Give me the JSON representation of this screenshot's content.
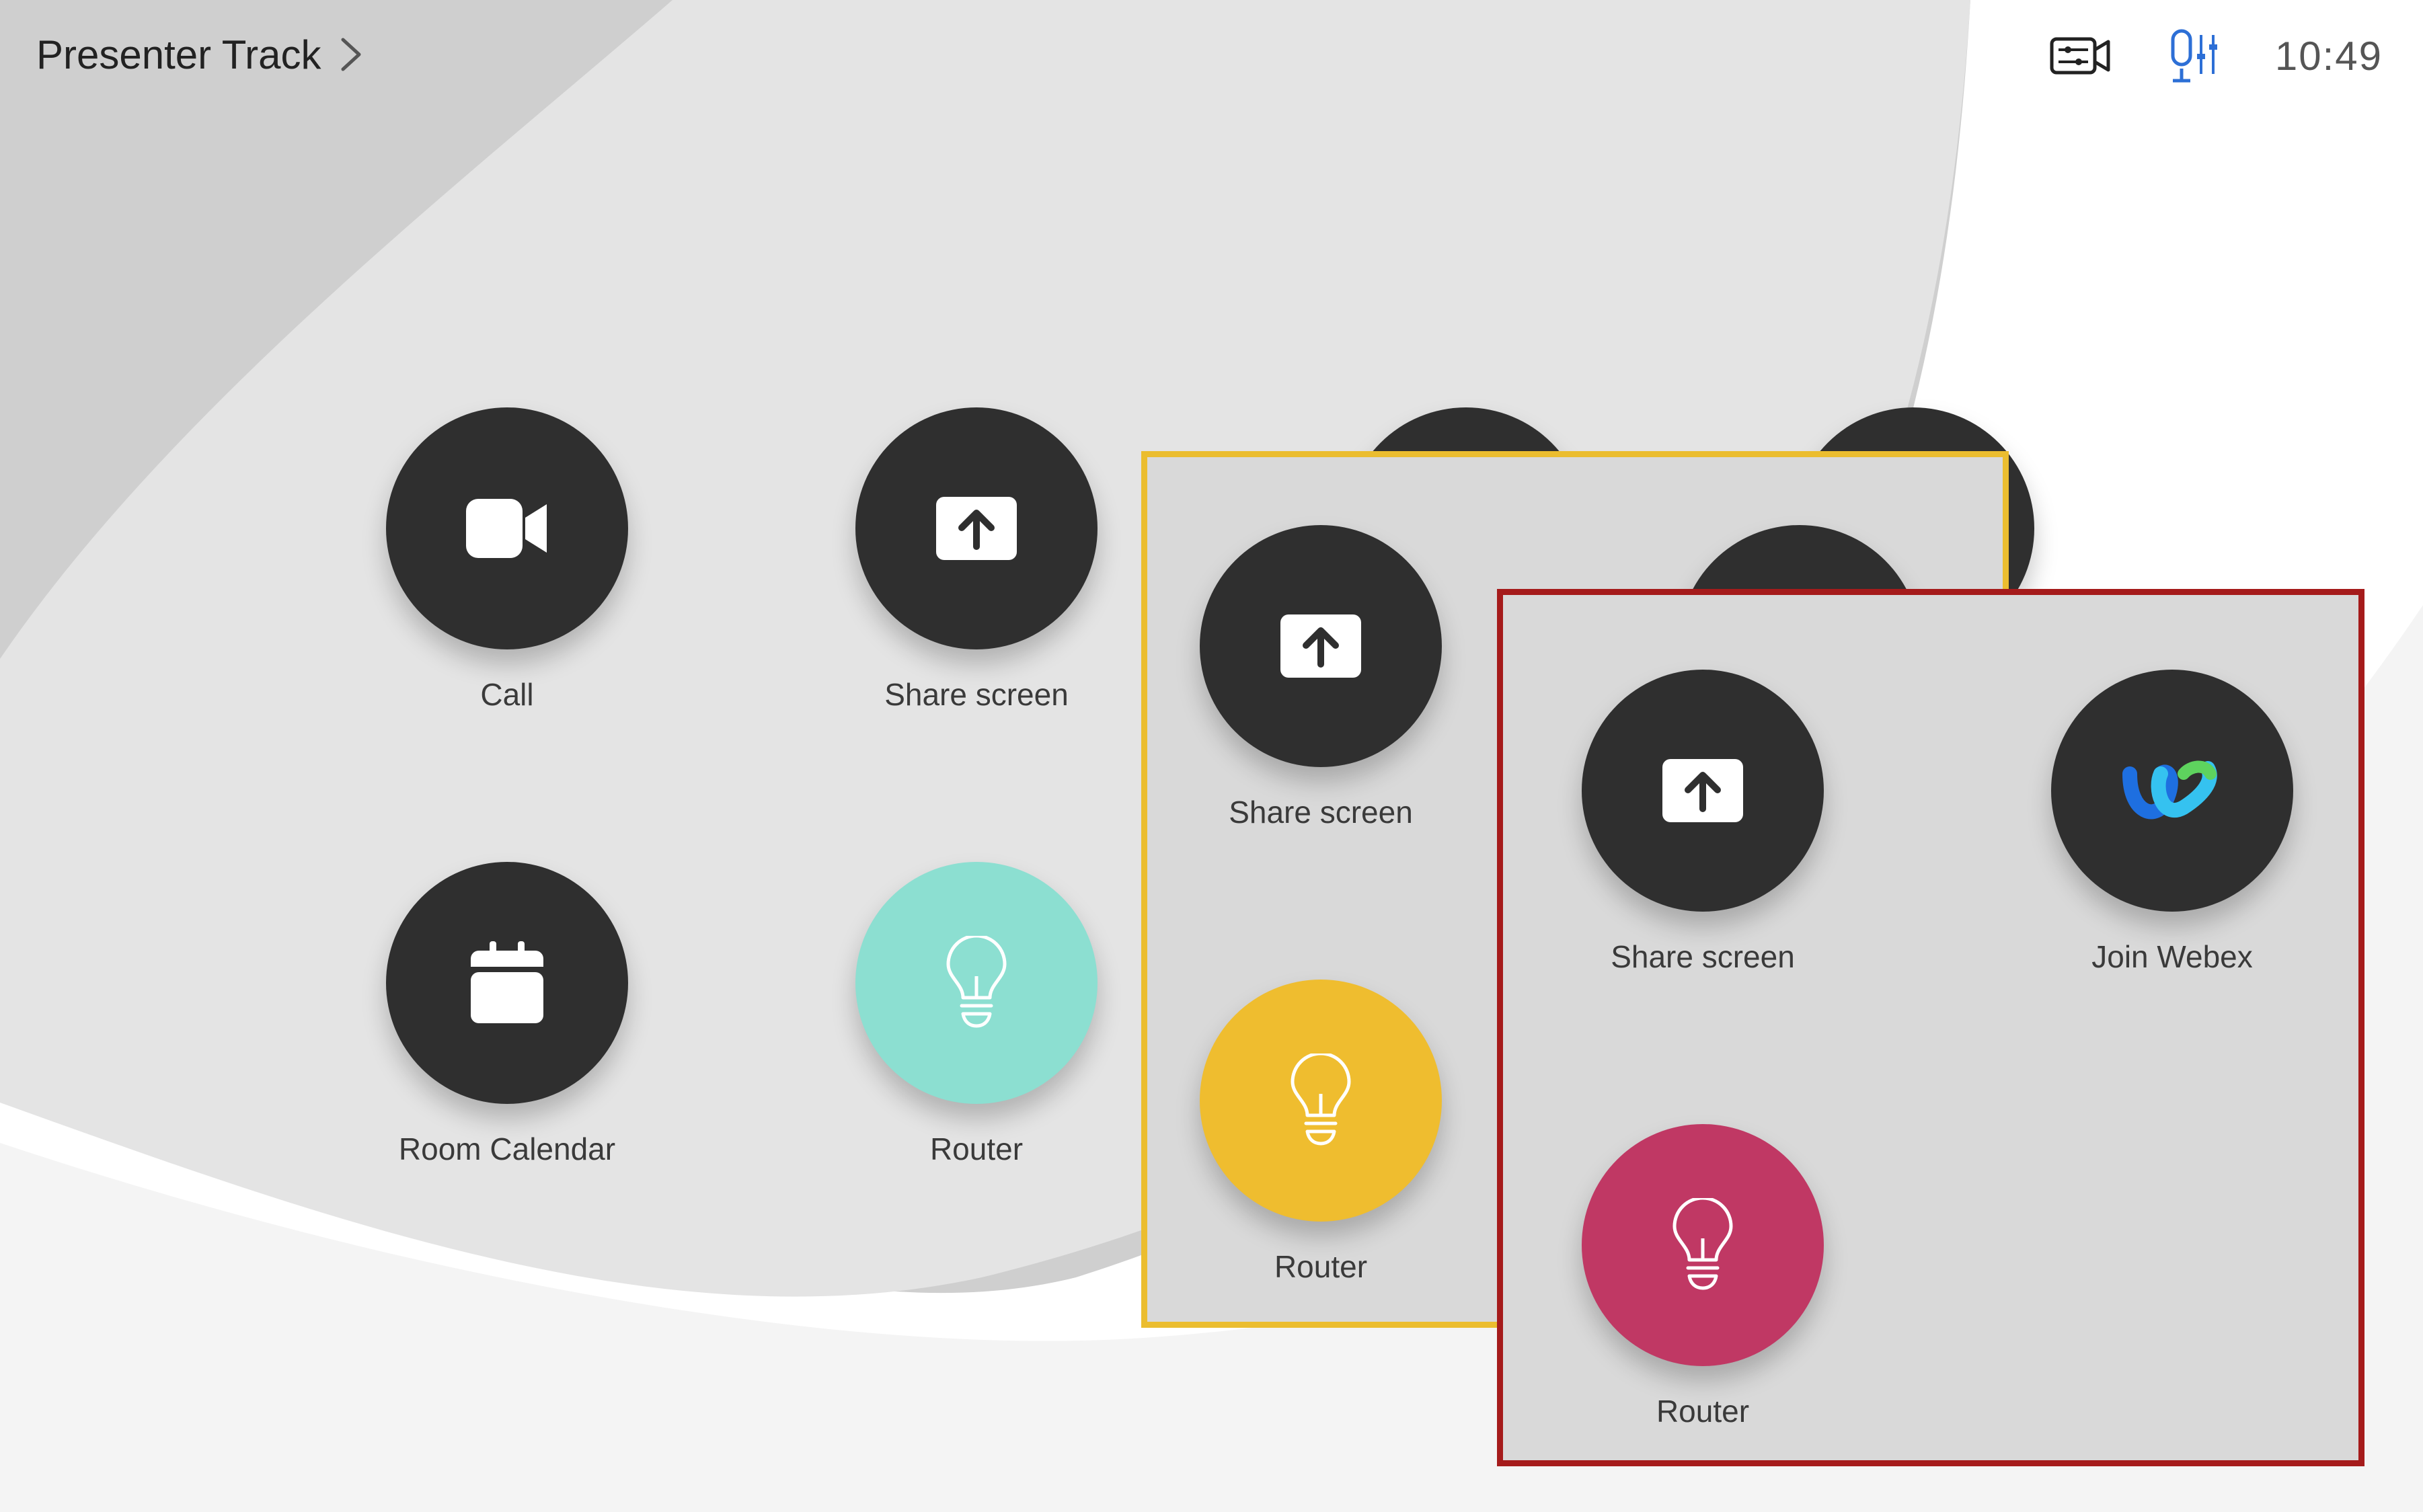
{
  "header": {
    "title": "Presenter Track",
    "time": "10:49"
  },
  "icons": {
    "chevron": "chevron-right-icon",
    "camera_control": "camera-settings-icon",
    "mic_control": "mic-settings-icon",
    "call": "video-camera-icon",
    "share": "share-screen-icon",
    "calendar": "calendar-icon",
    "router": "lightbulb-icon",
    "webex": "webex-logo-icon"
  },
  "colors": {
    "tile_dark": "#2f2f2f",
    "teal": "#8cdfd1",
    "yellow": "#efbd2f",
    "magenta": "#c03864",
    "frame_yellow": "#ebbd2f",
    "frame_red": "#a51b1b",
    "mic_icon": "#2d6fd6"
  },
  "main_grid": {
    "tiles": [
      {
        "label": "Call"
      },
      {
        "label": "Share screen"
      },
      {
        "label": "Room Calendar"
      },
      {
        "label": "Router"
      }
    ]
  },
  "yellow_panel": {
    "tiles": [
      {
        "label": "Share screen"
      },
      {
        "label": "Router"
      }
    ]
  },
  "red_panel": {
    "tiles": [
      {
        "label": "Share screen"
      },
      {
        "label": "Join Webex"
      },
      {
        "label": "Router"
      }
    ]
  }
}
